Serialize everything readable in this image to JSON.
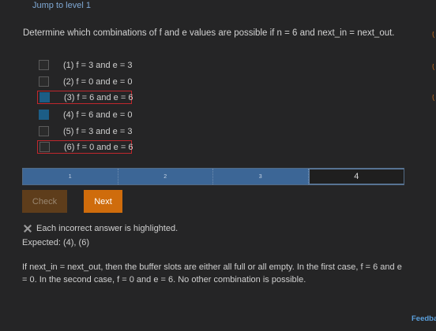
{
  "header": {
    "jump_link": "Jump to level 1"
  },
  "question": "Determine which combinations of f and e values are possible if n = 6 and next_in = next_out.",
  "options": [
    {
      "label": "(1) f = 3 and e = 3",
      "checked": false,
      "highlighted_incorrect": false
    },
    {
      "label": "(2) f = 0 and e = 0",
      "checked": false,
      "highlighted_incorrect": false
    },
    {
      "label": "(3) f = 6 and e = 6",
      "checked": true,
      "highlighted_incorrect": true
    },
    {
      "label": "(4) f = 6 and e = 0",
      "checked": true,
      "highlighted_incorrect": false
    },
    {
      "label": "(5) f = 3 and e = 3",
      "checked": false,
      "highlighted_incorrect": false
    },
    {
      "label": "(6) f = 0 and e = 6",
      "checked": false,
      "highlighted_incorrect": true
    }
  ],
  "progress": {
    "levels": [
      "1",
      "2",
      "3",
      "4"
    ],
    "current_level": 4
  },
  "buttons": {
    "check_label": "Check",
    "next_label": "Next"
  },
  "feedback": {
    "icon": "x-icon",
    "message": "Each incorrect answer is highlighted.",
    "expected": "Expected: (4), (6)"
  },
  "explanation": "If next_in = next_out, then the buffer slots are either all full or all empty. In the first case, f = 6 and e = 0. In the second case, f = 0 and e = 6. No other combination is possible.",
  "footer": {
    "feedback_link": "Feedback"
  },
  "colors": {
    "background": "#252526",
    "checked": "#1c5d86",
    "incorrect_outline": "#c0282d",
    "next_button": "#cf6c0c",
    "progress_fill": "#3c6696",
    "link": "#5aa0dd"
  }
}
